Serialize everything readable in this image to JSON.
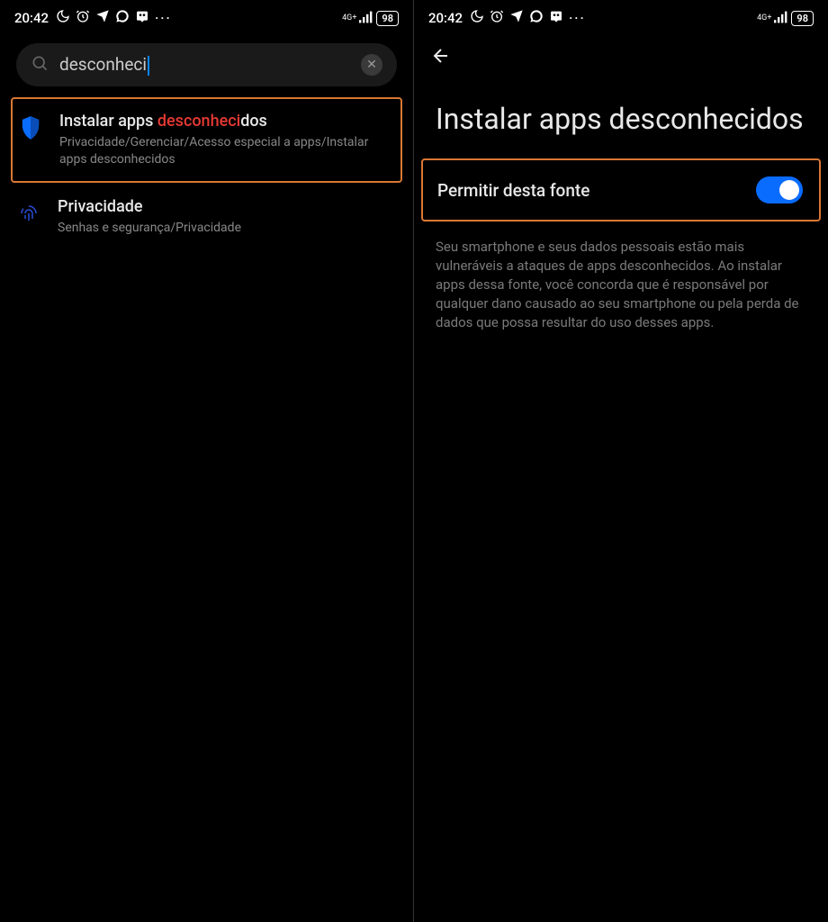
{
  "statusBar": {
    "time": "20:42",
    "networkLabel": "4G+",
    "battery": "98"
  },
  "left": {
    "searchQuery": "desconheci",
    "result1": {
      "titlePrefix": "Instalar apps ",
      "titleMatch": "desconheci",
      "titleSuffix": "dos",
      "path": "Privacidade/Gerenciar/Acesso especial a apps/Instalar apps desconhecidos"
    },
    "result2": {
      "title": "Privacidade",
      "path": "Senhas e segurança/Privacidade"
    }
  },
  "right": {
    "pageTitle": "Instalar apps desconhecidos",
    "toggleLabel": "Permitir desta fonte",
    "description": "Seu smartphone e seus dados pessoais estão mais vulneráveis a ataques de apps desconhecidos. Ao instalar apps dessa fonte, você concorda que é responsável por qualquer dano causado ao seu smartphone ou pela perda de dados que possa resultar do uso desses apps."
  }
}
